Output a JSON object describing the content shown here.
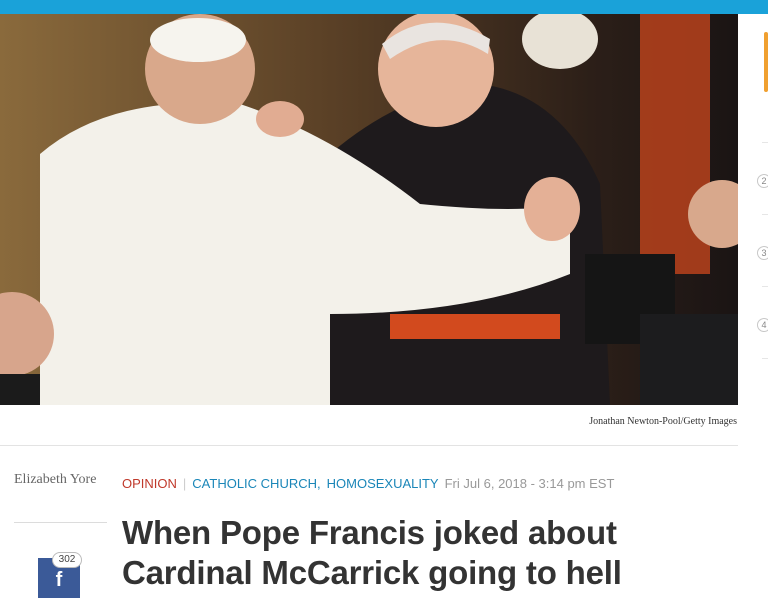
{
  "colors": {
    "top_bar": "#1aa2d9",
    "opinion": "#c0392b",
    "category_link": "#1a86b8",
    "facebook": "#3b5a98",
    "headline": "#333333"
  },
  "photo": {
    "credit": "Jonathan Newton-Pool/Getty Images"
  },
  "side_rail": {
    "numbers": [
      "2",
      "3",
      "4"
    ]
  },
  "article": {
    "author": "Elizabeth Yore",
    "section": "OPINION",
    "categories": [
      "CATHOLIC CHURCH",
      "HOMOSEXUALITY"
    ],
    "date": "Fri Jul 6, 2018 - 3:14 pm EST",
    "headline": "When Pope Francis joked about Cardinal McCarrick going to hell"
  },
  "share": {
    "count": "302",
    "icon": "facebook-icon",
    "glyph": "f"
  }
}
